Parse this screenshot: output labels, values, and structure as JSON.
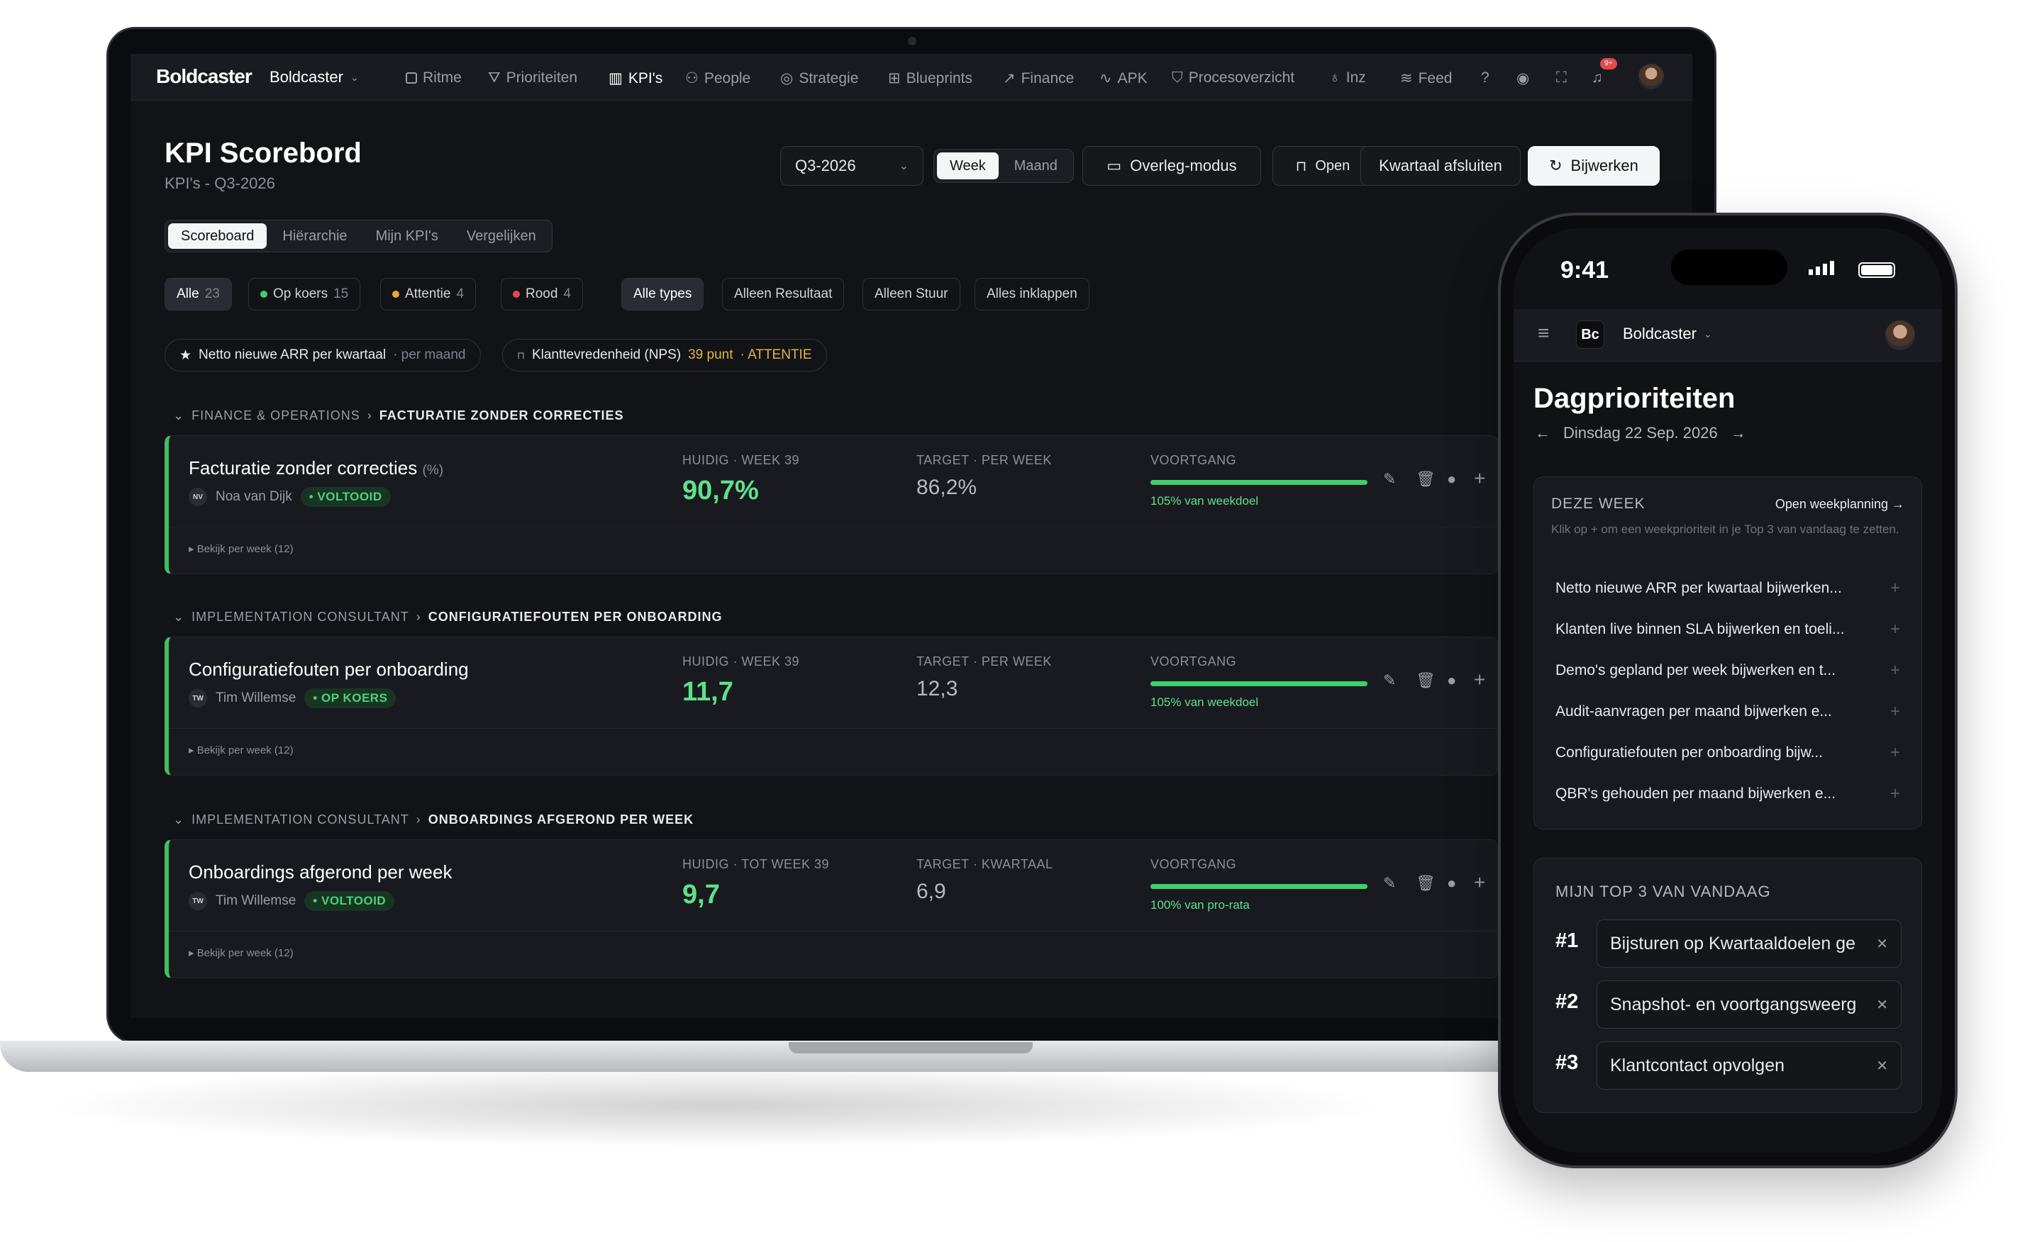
{
  "nav": {
    "logo": "Boldcaster",
    "org": "Boldcaster",
    "items": [
      "Ritme",
      "Prioriteiten",
      "KPI's",
      "People",
      "Strategie",
      "Blueprints",
      "Finance",
      "APK",
      "Procesoverzicht",
      "Inz",
      "Feed"
    ],
    "active_item": "KPI's",
    "notification_badge": "9+"
  },
  "header": {
    "title": "KPI Scorebord",
    "subtitle": "KPI's - Q3-2026",
    "period": "Q3-2026",
    "toggle": [
      "Week",
      "Maand"
    ],
    "toggle_selected": "Week",
    "overlay_button": "Overleg-modus",
    "open_button": "Open",
    "close_quarter_button": "Kwartaal afsluiten",
    "update_button": "Bijwerken"
  },
  "tabs": [
    "Scoreboard",
    "Hiërarchie",
    "Mijn KPI's",
    "Vergelijken"
  ],
  "tab_selected": "Scoreboard",
  "filters": {
    "status": [
      {
        "label": "Alle",
        "count": "23",
        "color": ""
      },
      {
        "label": "Op koers",
        "count": "15",
        "color": "#3fd06a"
      },
      {
        "label": "Attentie",
        "count": "4",
        "color": "#f0a23b"
      },
      {
        "label": "Rood",
        "count": "4",
        "color": "#e5484d"
      }
    ],
    "types": [
      "Alle types",
      "Alleen Resultaat",
      "Alleen Stuur",
      "Alles inklappen"
    ]
  },
  "pinned": [
    {
      "name": "Netto nieuwe ARR per kwartaal",
      "meta": "· per maand"
    },
    {
      "name": "Klanttevredenheid (NPS)",
      "value": "39 punt",
      "meta": "· ATTENTIE"
    }
  ],
  "sections": [
    {
      "path1": "FINANCE & OPERATIONS",
      "path2": "FACTURATIE ZONDER CORRECTIES",
      "kpi": "Facturatie zonder correcties",
      "unit": "(%)",
      "owner_initials": "NV",
      "owner": "Noa van Dijk",
      "status": "VOLTOOID",
      "current_label": "HUIDIG · WEEK 39",
      "current": "90,7%",
      "target_label": "TARGET · PER WEEK",
      "target": "86,2%",
      "progress_label": "VOORTGANG",
      "progress_pct": 100,
      "progress_text": "105% van weekdoel",
      "week_link": "▸ Bekijk per week (12)"
    },
    {
      "path1": "IMPLEMENTATION CONSULTANT",
      "path2": "CONFIGURATIEFOUTEN PER ONBOARDING",
      "kpi": "Configuratiefouten per onboarding",
      "unit": "",
      "owner_initials": "TW",
      "owner": "Tim Willemse",
      "status": "OP KOERS",
      "current_label": "HUIDIG · WEEK 39",
      "current": "11,7",
      "target_label": "TARGET · PER WEEK",
      "target": "12,3",
      "progress_label": "VOORTGANG",
      "progress_pct": 100,
      "progress_text": "105% van weekdoel",
      "week_link": "▸ Bekijk per week (12)"
    },
    {
      "path1": "IMPLEMENTATION CONSULTANT",
      "path2": "ONBOARDINGS AFGEROND PER WEEK",
      "kpi": "Onboardings afgerond per week",
      "unit": "",
      "owner_initials": "TW",
      "owner": "Tim Willemse",
      "status": "VOLTOOID",
      "current_label": "HUIDIG · TOT WEEK 39",
      "current": "9,7",
      "target_label": "TARGET · KWARTAAL",
      "target": "6,9",
      "progress_label": "VOORTGANG",
      "progress_pct": 100,
      "progress_text": "100% van pro-rata",
      "week_link": "▸ Bekijk per week (12)"
    }
  ],
  "phone": {
    "time": "9:41",
    "logo": "Bc",
    "org": "Boldcaster",
    "title": "Dagprioriteiten",
    "date": "Dinsdag 22 Sep. 2026",
    "week_panel": {
      "title": "DEZE WEEK",
      "link": "Open weekplanning →",
      "hint": "Klik op + om een weekprioriteit in je Top 3 van vandaag te zetten.",
      "items": [
        "Netto nieuwe ARR per kwartaal bijwerken...",
        "Klanten live binnen SLA bijwerken en toeli...",
        "Demo's gepland per week bijwerken en t...",
        "Audit-aanvragen per maand bijwerken e...",
        "Configuratiefouten per onboarding bijw...",
        "QBR's gehouden per maand bijwerken e..."
      ]
    },
    "top3_panel": {
      "title": "MIJN TOP 3 VAN VANDAAG",
      "items": [
        {
          "rank": "#1",
          "text": "Bijsturen op Kwartaaldoelen ge"
        },
        {
          "rank": "#2",
          "text": "Snapshot- en voortgangsweerg"
        },
        {
          "rank": "#3",
          "text": "Klantcontact opvolgen"
        }
      ]
    }
  },
  "colors": {
    "accent_green": "#3fd06a",
    "attention": "#f0a23b",
    "red": "#e5484d",
    "background": "#121317"
  }
}
